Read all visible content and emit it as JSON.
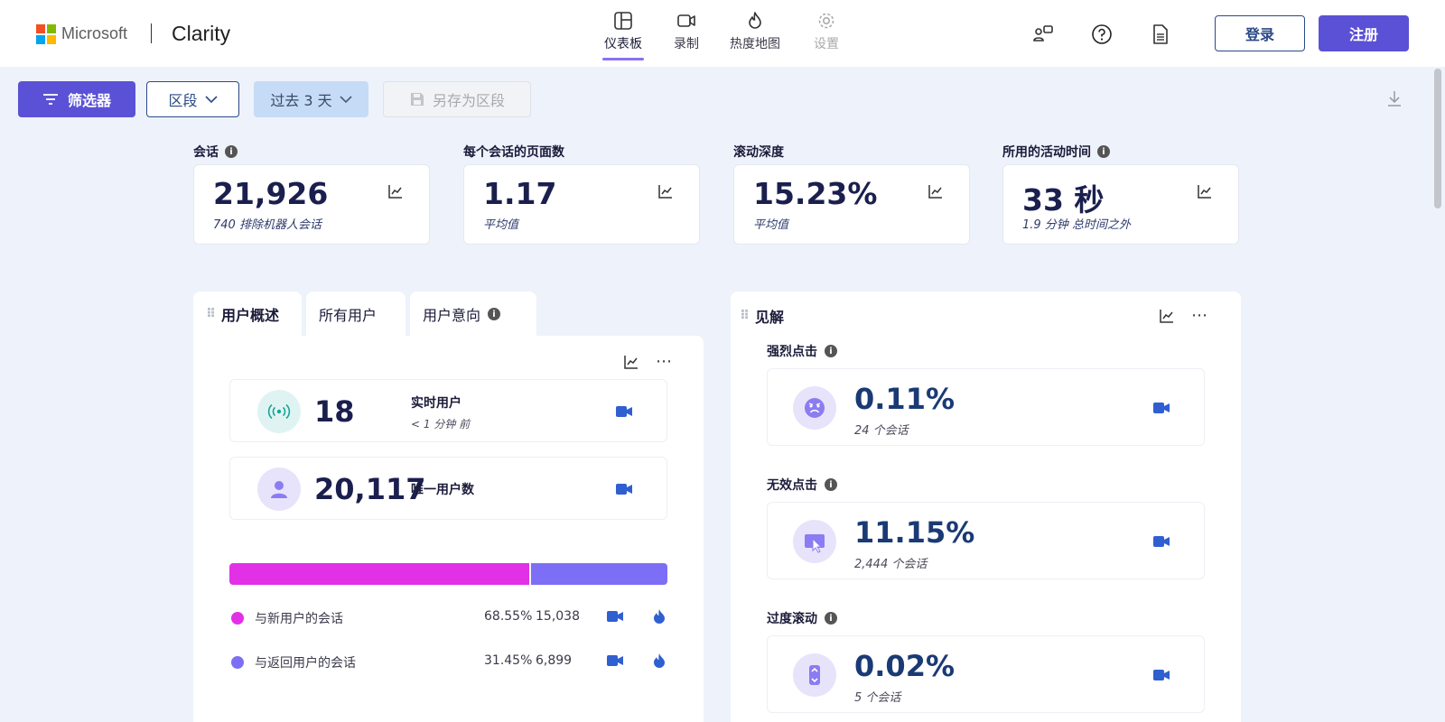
{
  "header": {
    "brand_company": "Microsoft",
    "brand_product": "Clarity",
    "nav": [
      {
        "label": "仪表板",
        "icon": "dashboard-icon"
      },
      {
        "label": "录制",
        "icon": "video-icon"
      },
      {
        "label": "热度地图",
        "icon": "heatmap-icon"
      },
      {
        "label": "设置",
        "icon": "gear-icon"
      }
    ],
    "login_label": "登录",
    "signup_label": "注册"
  },
  "filterbar": {
    "filter_label": "筛选器",
    "segment_label": "区段",
    "range_label": "过去 3 天",
    "save_label": "另存为区段"
  },
  "metrics": [
    {
      "label": "会话",
      "value": "21,926",
      "sub": "740 排除机器人会话",
      "info": true
    },
    {
      "label": "每个会话的页面数",
      "value": "1.17",
      "sub": "平均值",
      "info": false
    },
    {
      "label": "滚动深度",
      "value": "15.23%",
      "sub": "平均值",
      "info": false
    },
    {
      "label": "所用的活动时间",
      "value": "33 秒",
      "sub": "1.9 分钟 总时间之外",
      "info": true
    }
  ],
  "users_panel": {
    "tabs": [
      "用户概述",
      "所有用户",
      "用户意向"
    ],
    "live": {
      "value": "18",
      "title": "实时用户",
      "sub": "< 1 分钟 前"
    },
    "unique": {
      "value": "20,117",
      "title": "唯一用户数"
    },
    "split": {
      "new_fraction": 0.6855
    },
    "legend": [
      {
        "label": "与新用户的会话",
        "pct": "68.55%",
        "count": "15,038",
        "color": "#e230e6"
      },
      {
        "label": "与返回用户的会话",
        "pct": "31.45%",
        "count": "6,899",
        "color": "#7d6ff5"
      }
    ]
  },
  "insights_panel": {
    "title": "见解",
    "items": [
      {
        "label": "强烈点击",
        "value": "0.11%",
        "sub": "24 个会话",
        "icon": "angry-face-icon"
      },
      {
        "label": "无效点击",
        "value": "11.15%",
        "sub": "2,444 个会话",
        "icon": "dead-click-icon"
      },
      {
        "label": "过度滚动",
        "value": "0.02%",
        "sub": "5 个会话",
        "icon": "scroll-icon"
      }
    ]
  },
  "colors": {
    "accent": "#5b51d6",
    "new_users": "#e230e6",
    "returning_users": "#7d6ff5",
    "camera": "#2f5fd0"
  }
}
